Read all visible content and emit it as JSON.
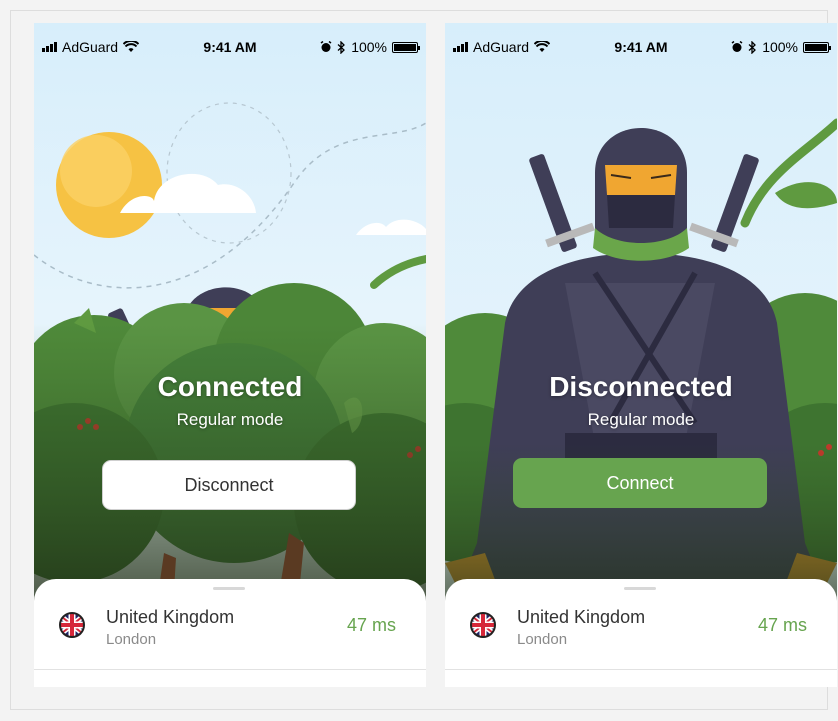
{
  "status": {
    "carrier": "AdGuard",
    "time": "9:41 AM",
    "battery": "100%"
  },
  "screens": [
    {
      "state": "Connected",
      "mode": "Regular mode",
      "button": "Disconnect",
      "location": {
        "country": "United Kingdom",
        "city": "London",
        "ping": "47 ms"
      }
    },
    {
      "state": "Disconnected",
      "mode": "Regular mode",
      "button": "Connect",
      "location": {
        "country": "United Kingdom",
        "city": "London",
        "ping": "47 ms"
      }
    }
  ],
  "icons": {
    "signal": "signal-bars-icon",
    "wifi": "wifi-icon",
    "alarm": "alarm-icon",
    "bluetooth": "bluetooth-icon",
    "battery": "battery-icon",
    "flag": "uk-flag-icon"
  },
  "colors": {
    "accent_green": "#67a44f",
    "sky": "#dff2fc",
    "foliage": "#4f8a3a",
    "ninja": "#3f3e57",
    "mask_skin": "#f0a631"
  }
}
